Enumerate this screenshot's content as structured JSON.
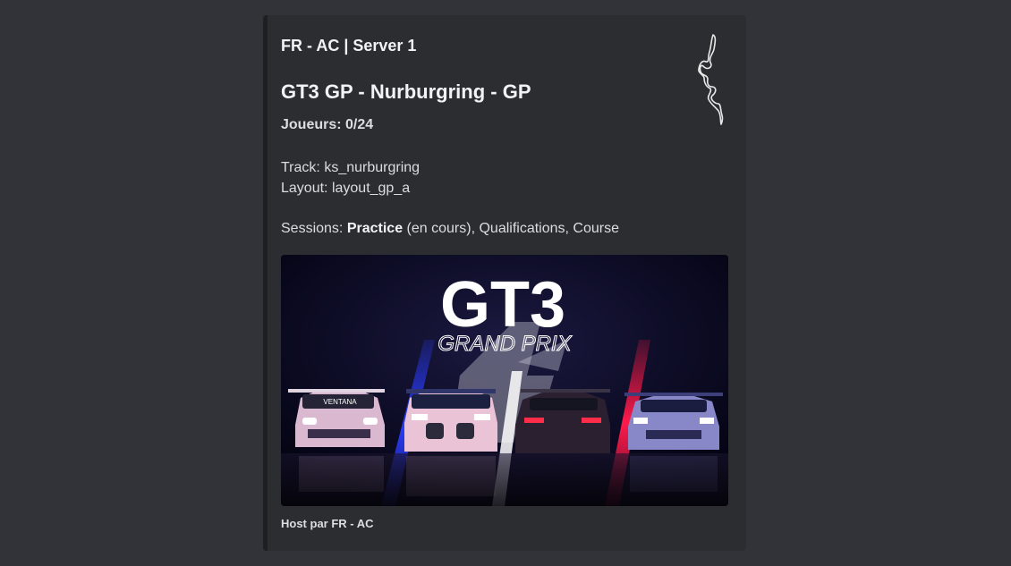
{
  "embed": {
    "author": "FR - AC | Server 1",
    "title": "GT3 GP - Nurburgring - GP",
    "players_label": "Joueurs:",
    "players_value": "0/24",
    "track_label": "Track:",
    "track_value": "ks_nurburgring",
    "layout_label": "Layout:",
    "layout_value": "layout_gp_a",
    "sessions_label": "Sessions:",
    "session_current": "Practice",
    "session_current_status": "(en cours),",
    "session_rest": "Qualifications, Course",
    "thumbnail_icon": "track-map-icon",
    "banner": {
      "logo_text": "GT3",
      "subtitle": "GRAND PRIX",
      "car_livery": "VENTANA"
    },
    "footer": "Host par FR - AC"
  },
  "colors": {
    "background": "#313338",
    "embed_bg": "#2b2d31",
    "embed_bar": "#1e1f22",
    "text": "#dbdee1",
    "heading": "#f2f3f5"
  }
}
